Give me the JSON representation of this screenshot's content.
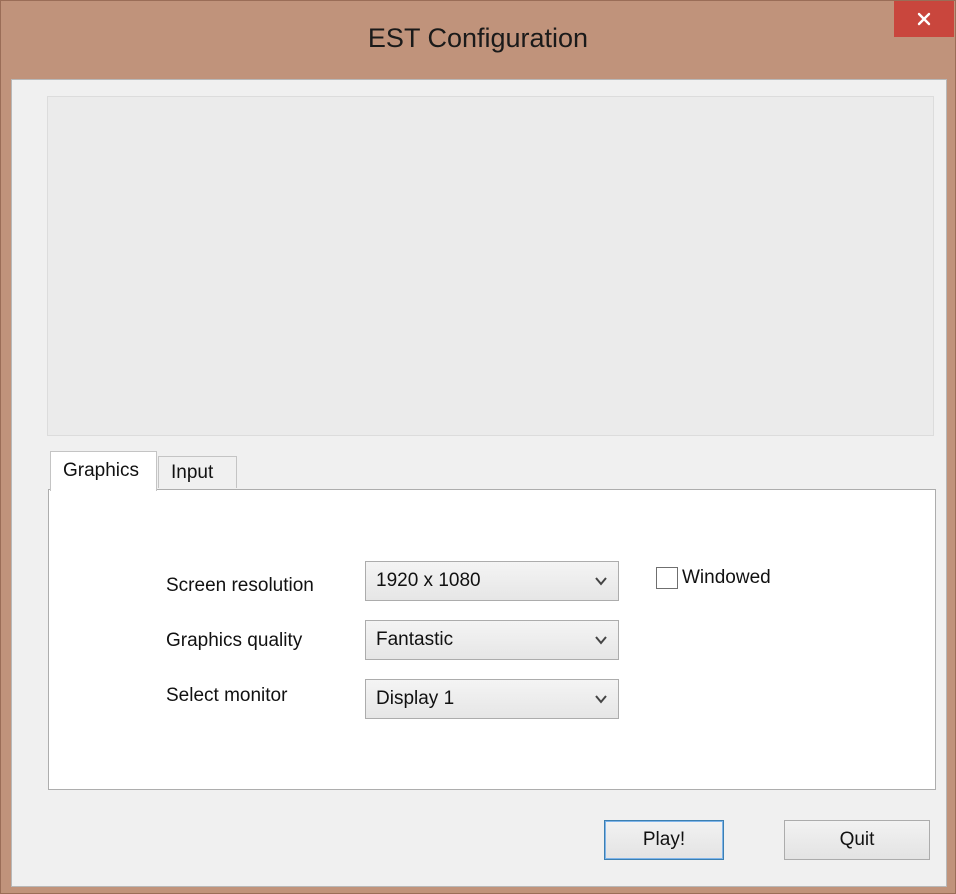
{
  "window": {
    "title": "EST Configuration"
  },
  "icons": {
    "close": "close-icon",
    "chevron": "chevron-down-icon"
  },
  "colors": {
    "titlebar": "#c0937b",
    "close_button": "#c9463d",
    "primary_button_border": "#3c7fb1"
  },
  "tabs": [
    {
      "label": "Graphics",
      "selected": true
    },
    {
      "label": "Input",
      "selected": false
    }
  ],
  "graphics": {
    "resolution": {
      "label": "Screen resolution",
      "value": "1920 x 1080"
    },
    "quality": {
      "label": "Graphics quality",
      "value": "Fantastic"
    },
    "monitor": {
      "label": "Select monitor",
      "value": "Display 1"
    },
    "windowed": {
      "label": "Windowed",
      "checked": false
    }
  },
  "buttons": {
    "play": "Play!",
    "quit": "Quit"
  }
}
